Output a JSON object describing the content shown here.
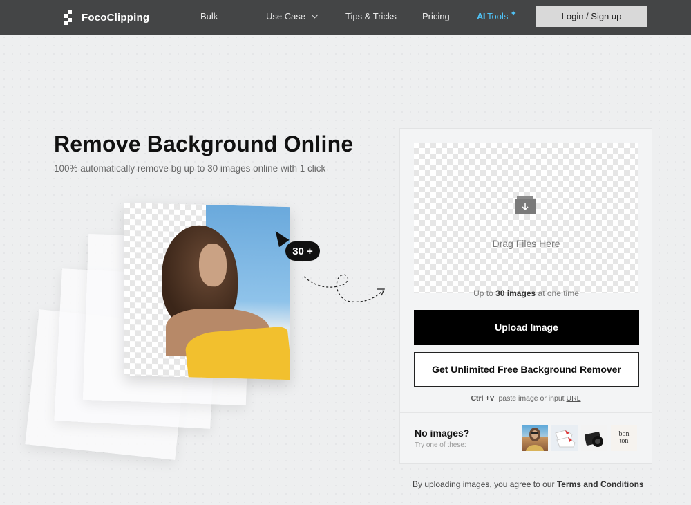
{
  "header": {
    "logo_text": "FocoClipping",
    "nav": [
      {
        "label": "Bulk"
      },
      {
        "label": "Use Case"
      },
      {
        "label": "Tips & Tricks"
      },
      {
        "label": "Pricing"
      }
    ],
    "ai_tools": {
      "prefix": "AI",
      "label": "Tools"
    },
    "login_label": "Login / Sign up"
  },
  "hero": {
    "title": "Remove Background Online",
    "subtitle": "100% automatically remove bg up to 30 images online with 1 click",
    "badge": "30 +"
  },
  "upload": {
    "drop_label": "Drag Files Here",
    "limit_prefix": "Up to",
    "limit_count": "30 images",
    "limit_suffix": "at one time",
    "upload_button": "Upload Image",
    "free_button": "Get Unlimited Free Background Remover",
    "paste_key": "Ctrl +V",
    "paste_text": "paste image or input",
    "paste_url": "URL"
  },
  "samples": {
    "title": "No images?",
    "subtitle": "Try one of these:",
    "brand_text_1": "bon",
    "brand_text_2": "ton"
  },
  "footer": {
    "terms_prefix": "By uploading images, you agree to our",
    "terms_link": "Terms and Conditions"
  },
  "colors": {
    "header_bg": "#444546",
    "accent_ai": "#4fc3f7",
    "primary_button": "#000000"
  }
}
